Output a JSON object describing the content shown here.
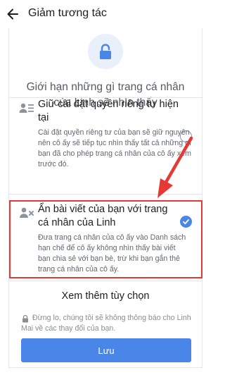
{
  "appbar": {
    "title": "Giảm tương tác",
    "back_icon": "arrow-left-icon"
  },
  "header": {
    "icon": "lock-icon",
    "text": "Giới hạn những gì trang cá nhân của Linh sẽ nhìn thấy"
  },
  "options": [
    {
      "icon": "privacy-list-icon",
      "title": "Giữ cài đặt quyền riêng tư hiện tại",
      "description": "Cài đặt quyền riêng tư của bạn sẽ giữ nguyên nên cô ấy sẽ tiếp tục nhìn thấy tất cả những gì bạn đã cho phép trang cá nhân của cô ấy xem trước đó.",
      "selected": false
    },
    {
      "icon": "hide-user-icon",
      "title": "Ẩn bài viết của bạn với trang cá nhân của Linh",
      "description": "Đưa trang cá nhân của cô ấy vào Danh sách hạn chế để cô ấy không nhìn thấy bài viết bạn chia sẻ với bạn bè, trừ khi bạn gắn thẻ trang cá nhân của cô ấy.",
      "selected": true
    }
  ],
  "see_more": "Xem thêm tùy chọn",
  "notice": "Đừng lo, chúng tôi sẽ không thông báo cho Linh Mai về các thay đổi của bạn.",
  "save_button": "Lưu",
  "colors": {
    "accent": "#4a86e8",
    "highlight_box": "#e53935",
    "annotation_arrow": "#e53935"
  }
}
